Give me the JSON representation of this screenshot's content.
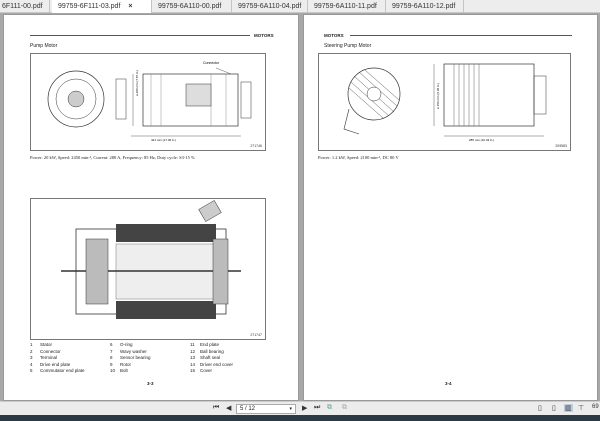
{
  "tabs": [
    {
      "label": "6F111-00.pdf",
      "active": false
    },
    {
      "label": "99759-6F111-03.pdf",
      "active": true
    },
    {
      "label": "99759-6A110-00.pdf",
      "active": false
    },
    {
      "label": "99759-6A110-04.pdf",
      "active": false
    },
    {
      "label": "99759-6A110-11.pdf",
      "active": false
    },
    {
      "label": "99759-6A110-12.pdf",
      "active": false
    }
  ],
  "close_glyph": "×",
  "left_page": {
    "section": "MOTORS",
    "title": "Pump Motor",
    "fig1": {
      "id": "271746",
      "dim_label": "441 mm (17.36 in.)",
      "connector_label": "Connector",
      "height_label": "ø 200 mm (7.87 in.)"
    },
    "caption": "Power: 20 kW, Speed: 2450 min-¹, Current: 280 A, Frequency: 85 Hz, Duty cycle: S3-15 %",
    "fig2": {
      "id": "271747"
    },
    "legend": [
      {
        "n": "1",
        "t": "Stator"
      },
      {
        "n": "6",
        "t": "O-ring"
      },
      {
        "n": "11",
        "t": "End plate"
      },
      {
        "n": "2",
        "t": "Connector"
      },
      {
        "n": "7",
        "t": "Wavy washer"
      },
      {
        "n": "12",
        "t": "Ball bearing"
      },
      {
        "n": "3",
        "t": "Terminal"
      },
      {
        "n": "8",
        "t": "Sensor bearing"
      },
      {
        "n": "13",
        "t": "Shaft seal"
      },
      {
        "n": "4",
        "t": "Drive end plate"
      },
      {
        "n": "9",
        "t": "Rotor"
      },
      {
        "n": "14",
        "t": "Driver end cover"
      },
      {
        "n": "5",
        "t": "Commutator end plate"
      },
      {
        "n": "10",
        "t": "Bolt"
      },
      {
        "n": "15",
        "t": "Cover"
      }
    ],
    "page_number": "3-3"
  },
  "right_page": {
    "section": "MOTORS",
    "title": "Steering Pump Motor",
    "fig": {
      "id": "209583",
      "dim_label": "285 mm (10.43 in.)",
      "height_label": "ø 156 mm (6.06 in.)"
    },
    "caption": "Power: 1.2 kW, Speed: 2100 min-¹, DC 80 V",
    "page_number": "3-4"
  },
  "toolbar": {
    "page_value": "5 / 12",
    "zoom": "69"
  }
}
